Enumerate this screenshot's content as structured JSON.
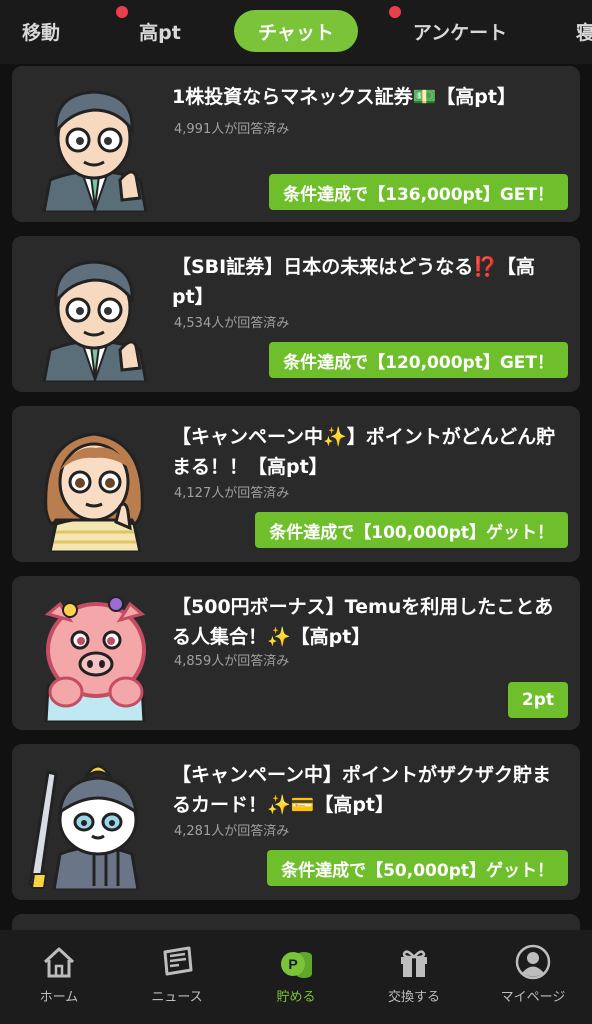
{
  "top_tabs": [
    {
      "label": "移動"
    },
    {
      "label": "高pt"
    },
    {
      "label": "チャット"
    },
    {
      "label": "アンケート"
    },
    {
      "label": "寝"
    }
  ],
  "cards": [
    {
      "title": "1株投資ならマネックス証券💵【高pt】",
      "count": "4,991人が回答済み",
      "reward": "条件達成で【136,000pt】GET！",
      "avatar": "businessman-avatar"
    },
    {
      "title": "【SBI証券】日本の未来はどうなる⁉️【高pt】",
      "count": "4,534人が回答済み",
      "reward": "条件達成で【120,000pt】GET！",
      "avatar": "businessman-avatar"
    },
    {
      "title": "【キャンペーン中✨】ポイントがどんどん貯まる！！【高pt】",
      "count": "4,127人が回答済み",
      "reward": "条件達成で【100,000pt】ゲット！",
      "avatar": "girl-avatar"
    },
    {
      "title": "【500円ボーナス】Temuを利用したことある人集合！✨【高pt】",
      "count": "4,859人が回答済み",
      "reward": "2pt",
      "avatar": "pig-avatar"
    },
    {
      "title": "【キャンペーン中】ポイントがザクザク貯まるカード！✨💳【高pt】",
      "count": "4,281人が回答済み",
      "reward": "条件達成で【50,000pt】ゲット！",
      "avatar": "samurai-cat-avatar"
    }
  ],
  "bottom_nav": [
    {
      "label": "ホーム",
      "icon": "home-icon"
    },
    {
      "label": "ニュース",
      "icon": "newspaper-icon"
    },
    {
      "label": "貯める",
      "icon": "coins-icon"
    },
    {
      "label": "交換する",
      "icon": "gift-icon"
    },
    {
      "label": "マイページ",
      "icon": "user-icon"
    }
  ],
  "colors": {
    "accent": "#7bc43a",
    "reward_bg": "#6fbf2c",
    "badge": "#e8404a",
    "card_bg": "#2a2a2a"
  }
}
